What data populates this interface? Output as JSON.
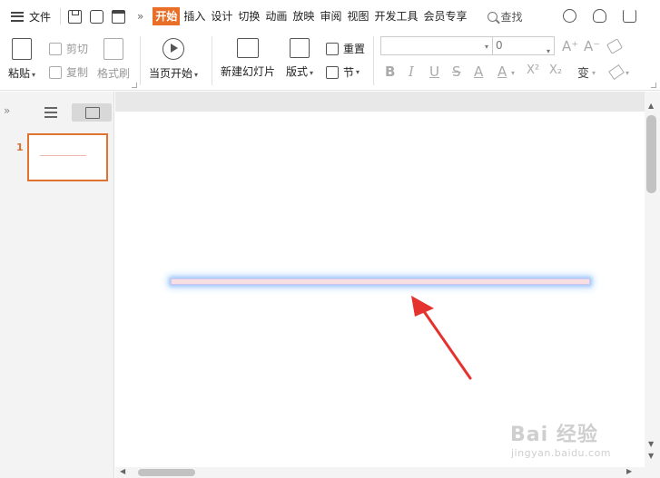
{
  "menubar": {
    "file_label": "文件",
    "more_glyph": "»",
    "tabs": [
      {
        "label": "开始",
        "active": true
      },
      {
        "label": "插入",
        "active": false
      },
      {
        "label": "设计",
        "active": false
      },
      {
        "label": "切换",
        "active": false
      },
      {
        "label": "动画",
        "active": false
      },
      {
        "label": "放映",
        "active": false
      },
      {
        "label": "审阅",
        "active": false
      },
      {
        "label": "视图",
        "active": false
      },
      {
        "label": "开发工具",
        "active": false
      },
      {
        "label": "会员专享",
        "active": false
      }
    ],
    "search_label": "查找",
    "accent_color": "#e96f28"
  },
  "ribbon": {
    "paste_label": "粘贴",
    "cut_label": "剪切",
    "copy_label": "复制",
    "format_painter_label": "格式刷",
    "from_start_label": "当页开始",
    "new_slide_label": "新建幻灯片",
    "layout_label": "版式",
    "reset_label": "重置",
    "section_label": "节",
    "font_size_value": "0",
    "caret_glyph": "▾",
    "font_grow_glyph": "A⁺",
    "font_shrink_glyph": "A⁻",
    "bold_glyph": "B",
    "italic_glyph": "I",
    "underline_glyph": "U",
    "strike_glyph": "S",
    "font_color_glyph": "A",
    "superscript_glyph": "X²",
    "subscript_glyph": "X₂",
    "phonetic_glyph": "变"
  },
  "slides_panel": {
    "collapse_glyph": "»",
    "slides": [
      {
        "number": "1"
      }
    ]
  },
  "scrollbars": {
    "up_glyph": "▲",
    "down_glyph": "▼",
    "left_glyph": "◀",
    "right_glyph": "▶"
  },
  "watermark": {
    "line1": "Bai 经验",
    "line2": "jingyan.baidu.com"
  },
  "colors": {
    "line_fill": "#f7dfe4",
    "line_glow": "#a8cdfa",
    "arrow": "#e5322e",
    "thumb_border": "#e0732f"
  },
  "icons": [
    "menu-icon",
    "save-icon",
    "redo-icon",
    "print-icon",
    "search-icon",
    "cloud-icon",
    "user-icon",
    "share-icon",
    "paste-icon",
    "cut-icon",
    "copy-icon",
    "format-painter-icon",
    "play-icon",
    "new-slide-icon",
    "layout-icon",
    "reset-icon",
    "section-icon",
    "outline-view-icon",
    "thumbnail-view-icon",
    "clear-format-icon",
    "highlight-icon"
  ]
}
